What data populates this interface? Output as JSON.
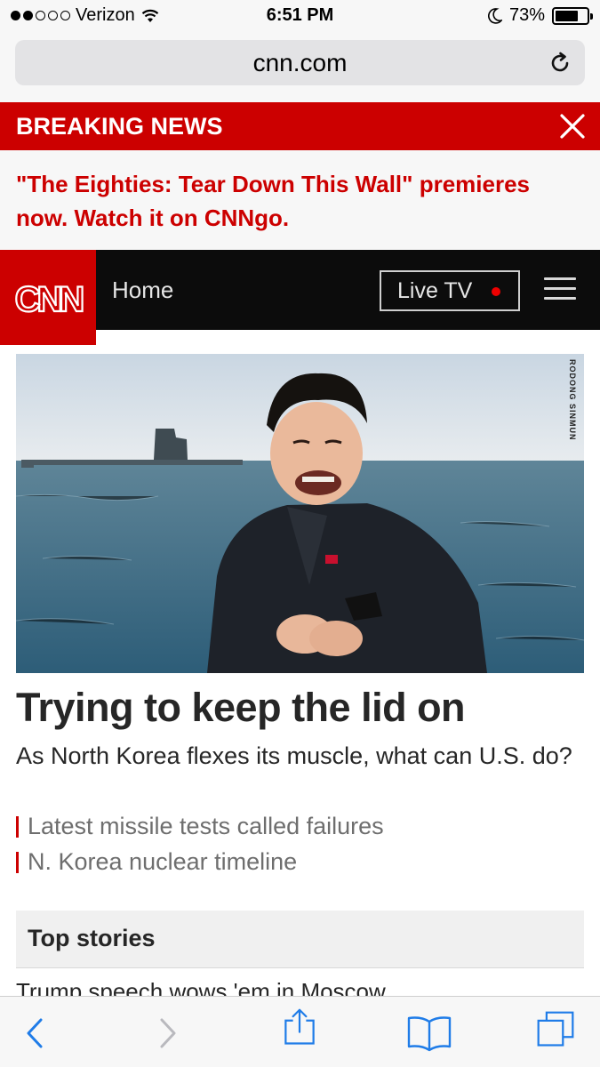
{
  "status_bar": {
    "carrier": "Verizon",
    "time": "6:51 PM",
    "battery": "73%",
    "battery_level": 0.73,
    "signal_bars_filled": 2,
    "signal_bars_total": 5
  },
  "browser": {
    "url": "cnn.com"
  },
  "breaking": {
    "label": "BREAKING NEWS",
    "text": "\"The Eighties: Tear Down This Wall\" premieres now. Watch it on CNNgo."
  },
  "nav": {
    "logo": "CNN",
    "section": "Home",
    "live_tv": "Live TV"
  },
  "hero": {
    "credit": "RODONG SINMUN"
  },
  "story": {
    "headline": "Trying to keep the lid on",
    "subhead": "As North Korea flexes its muscle, what can U.S. do?",
    "related": [
      "Latest missile tests called failures",
      "N. Korea nuclear timeline"
    ]
  },
  "top_stories": {
    "title": "Top stories",
    "first_item": "Trump speech wows 'em in Moscow"
  },
  "colors": {
    "cnn_red": "#cc0000",
    "nav_black": "#0c0c0c",
    "ios_blue": "#1f7ce8"
  }
}
